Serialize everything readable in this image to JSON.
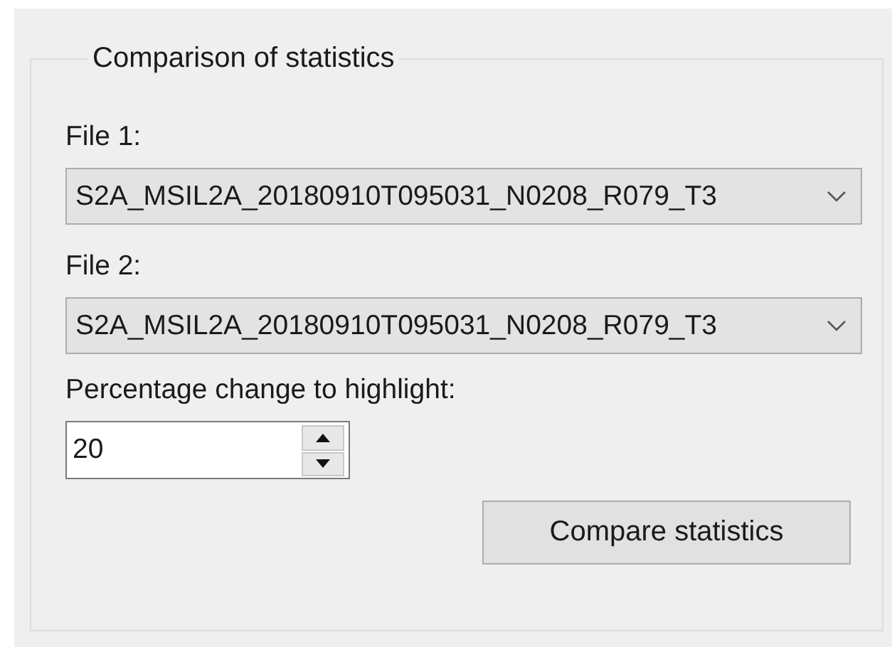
{
  "group": {
    "title": "Comparison of statistics",
    "file_1": {
      "label": "File 1:",
      "value": "S2A_MSIL2A_20180910T095031_N0208_R079_T3"
    },
    "file_2": {
      "label": "File 2:",
      "value": "S2A_MSIL2A_20180910T095031_N0208_R079_T3"
    },
    "percentage": {
      "label": "Percentage change to highlight:",
      "value": "20"
    },
    "button": "Compare statistics"
  }
}
